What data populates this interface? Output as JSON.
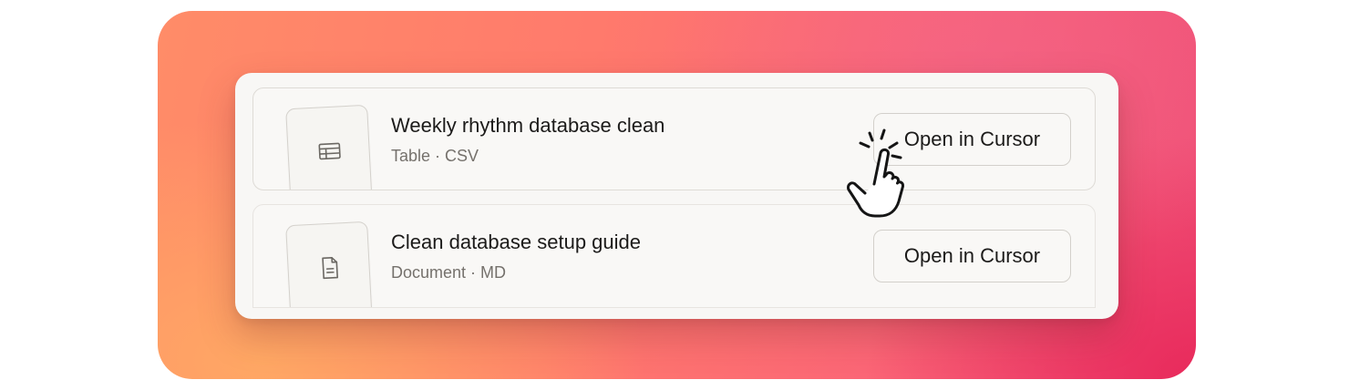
{
  "items": [
    {
      "title": "Weekly rhythm database clean",
      "meta": "Table · CSV",
      "icon": "table-icon",
      "button_label": "Open in Cursor"
    },
    {
      "title": "Clean database setup guide",
      "meta": "Document · MD",
      "icon": "document-icon",
      "button_label": "Open in Cursor"
    }
  ],
  "pointer": {
    "icon": "pointer-hand-click-icon",
    "state": "hovering first Open in Cursor button"
  },
  "colors": {
    "panel_bg": "#f8f7f5",
    "text_primary": "#1c1b1a",
    "text_secondary": "#75716c",
    "backdrop_orange": "#ffa064",
    "backdrop_pink": "#ef4f77"
  }
}
